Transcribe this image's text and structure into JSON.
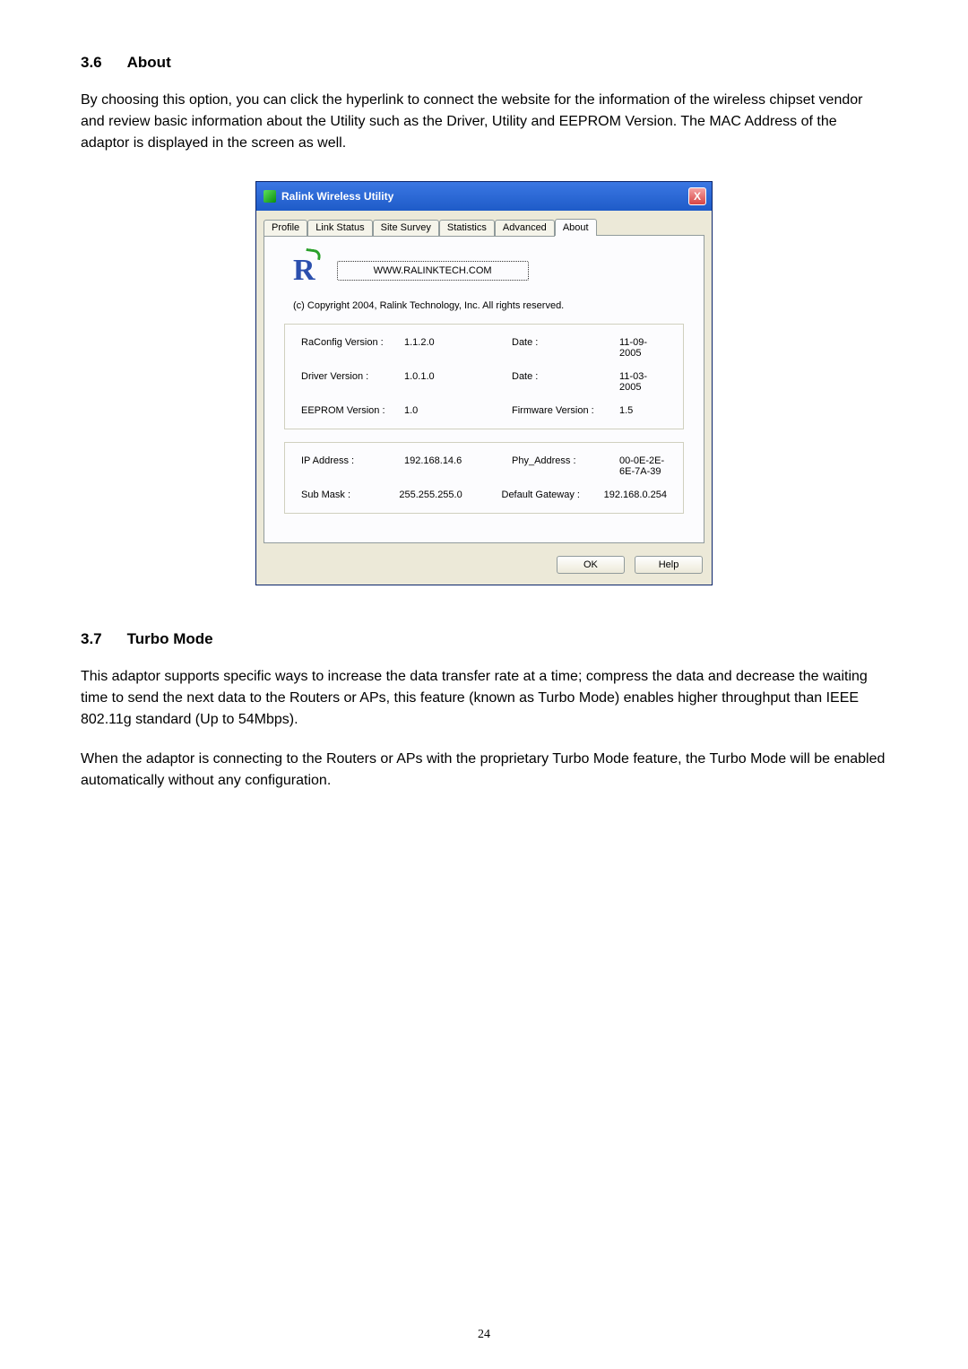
{
  "section36": {
    "num": "3.6",
    "title": "About",
    "p1": "By choosing this option, you can click the hyperlink to connect the website for the information of the wireless chipset vendor and review basic information about the Utility such as the Driver, Utility and EEPROM Version. The MAC Address of the adaptor is displayed in the screen as well."
  },
  "dialog": {
    "title": "Ralink Wireless Utility",
    "close": "X",
    "tabs": [
      "Profile",
      "Link Status",
      "Site Survey",
      "Statistics",
      "Advanced",
      "About"
    ],
    "link": "WWW.RALINKTECH.COM",
    "copyright": "(c) Copyright 2004, Ralink Technology, Inc. All rights reserved.",
    "r1": {
      "a": "RaConfig Version :",
      "b": "1.1.2.0",
      "c": "Date :",
      "d": "11-09-2005"
    },
    "r2": {
      "a": "Driver Version :",
      "b": "1.0.1.0",
      "c": "Date :",
      "d": "11-03-2005"
    },
    "r3": {
      "a": "EEPROM Version :",
      "b": "1.0",
      "c": "Firmware Version :",
      "d": "1.5"
    },
    "r4": {
      "a": "IP Address :",
      "b": "192.168.14.6",
      "c": "Phy_Address :",
      "d": "00-0E-2E-6E-7A-39"
    },
    "r5": {
      "a": "Sub Mask :",
      "b": "255.255.255.0",
      "c": "Default Gateway :",
      "d": "192.168.0.254"
    },
    "ok": "OK",
    "help": "Help"
  },
  "section37": {
    "num": "3.7",
    "title": "Turbo Mode",
    "p1": "This adaptor supports specific ways to increase the data transfer rate at a time; compress the data and decrease the waiting time to send the next data to the Routers or APs, this feature (known as Turbo Mode) enables higher throughput than IEEE 802.11g standard (Up to 54Mbps).",
    "p2": "When the adaptor is connecting to the Routers or APs with the proprietary Turbo Mode feature, the Turbo Mode will be enabled automatically without any configuration."
  },
  "pageNum": "24"
}
